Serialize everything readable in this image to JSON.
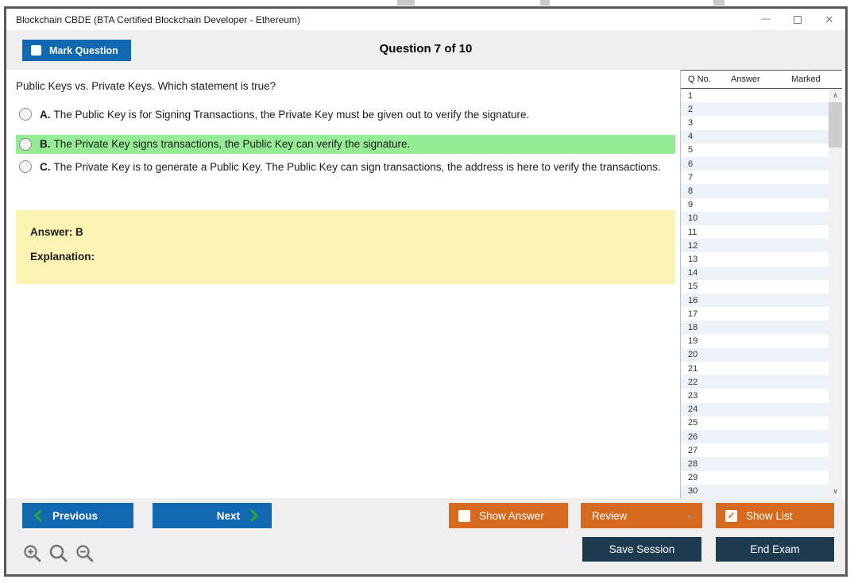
{
  "window": {
    "title": "Blockchain CBDE (BTA Certified Blockchain Developer - Ethereum)",
    "controls": {
      "minimize": "—",
      "close": "✕"
    }
  },
  "header": {
    "mark_question": "Mark Question",
    "counter": "Question 7 of 10"
  },
  "question": {
    "text": "Public Keys vs. Private Keys. Which statement is true?",
    "options": [
      {
        "letter": "A.",
        "text": "The Public Key is for Signing Transactions, the Private Key must be given out to verify the signature."
      },
      {
        "letter": "B.",
        "text": "The Private Key signs transactions, the Public Key can verify the signature."
      },
      {
        "letter": "C.",
        "text": "The Private Key is to generate a Public Key. The Public Key can sign transactions, the address is here to verify the transactions."
      }
    ],
    "highlighted_option": "B"
  },
  "answer_panel": {
    "answer": "Answer: B",
    "explanation": "Explanation:"
  },
  "question_list": {
    "columns": [
      "Q No.",
      "Answer",
      "Marked"
    ],
    "rows": [
      "1",
      "2",
      "3",
      "4",
      "5",
      "6",
      "7",
      "8",
      "9",
      "10",
      "11",
      "12",
      "13",
      "14",
      "15",
      "16",
      "17",
      "18",
      "19",
      "20",
      "21",
      "22",
      "23",
      "24",
      "25",
      "26",
      "27",
      "28",
      "29",
      "30"
    ],
    "scroll_up_glyph": "∧",
    "scroll_down_glyph": "∨"
  },
  "footer": {
    "previous": "Previous",
    "next": "Next",
    "show_answer": "Show Answer",
    "review": "Review",
    "review_caret": "▲",
    "show_list": "Show List",
    "show_list_check": "✓",
    "save_session": "Save Session",
    "end_exam": "End Exam"
  },
  "colors": {
    "accent_blue": "#1268b1",
    "accent_orange": "#d5691d",
    "accent_navy": "#1e3a4e",
    "highlight_green": "#95ec95",
    "panel_yellow": "#fbf3b2",
    "row_alt_blue": "#edf2f9",
    "chevron_green": "#2fa82f"
  }
}
